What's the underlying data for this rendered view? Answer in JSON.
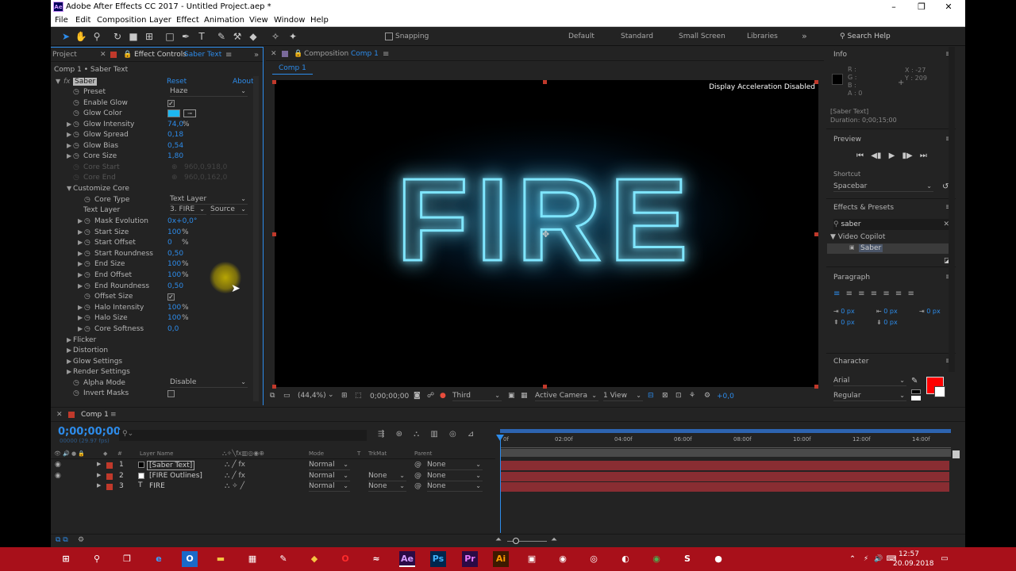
{
  "app": {
    "title": "Adobe After Effects CC 2017 - Untitled Project.aep *",
    "logo": "Ae"
  },
  "window_controls": {
    "minimize": "–",
    "maximize": "❐",
    "close": "✕"
  },
  "menu": [
    "File",
    "Edit",
    "Composition",
    "Layer",
    "Effect",
    "Animation",
    "View",
    "Window",
    "Help"
  ],
  "toolbar": {
    "snapping": "Snapping",
    "workspaces": [
      "Default",
      "Standard",
      "Small Screen",
      "Libraries"
    ],
    "search_help": "Search Help"
  },
  "project_panel": {
    "tab": "Project",
    "effect_controls_label": "Effect Controls",
    "effect_controls_layer": "Saber Text",
    "breadcrumb": "Comp 1 • Saber Text"
  },
  "effect": {
    "fx": "fx",
    "name": "Saber",
    "reset": "Reset",
    "about": "About",
    "preset_label": "Preset",
    "preset_value": "Haze",
    "props": [
      {
        "label": "Enable Glow",
        "type": "check",
        "value": "✓"
      },
      {
        "label": "Glow Color",
        "type": "color",
        "value": ""
      },
      {
        "label": "Glow Intensity",
        "value": "74,0",
        "unit": "%"
      },
      {
        "label": "Glow Spread",
        "value": "0,18"
      },
      {
        "label": "Glow Bias",
        "value": "0,54"
      },
      {
        "label": "Core Size",
        "value": "1,80"
      },
      {
        "label": "Core Start",
        "value": "960,0,918,0",
        "dim": true
      },
      {
        "label": "Core End",
        "value": "960,0,162,0",
        "dim": true
      }
    ],
    "customize_core": "Customize Core",
    "core_type_label": "Core Type",
    "core_type_value": "Text Layer",
    "text_layer_label": "Text Layer",
    "text_layer_value": "3. FIRE",
    "text_layer_source": "Source",
    "sub": [
      {
        "label": "Mask Evolution",
        "value": "0x+0,0°"
      },
      {
        "label": "Start Size",
        "value": "100",
        "unit": "%"
      },
      {
        "label": "Start Offset",
        "value": "0",
        "unit": "%"
      },
      {
        "label": "Start Roundness",
        "value": "0,50"
      },
      {
        "label": "End Size",
        "value": "100",
        "unit": "%"
      },
      {
        "label": "End Offset",
        "value": "100",
        "unit": "%"
      },
      {
        "label": "End Roundness",
        "value": "0,50"
      },
      {
        "label": "Offset Size",
        "type": "check",
        "value": "✓"
      },
      {
        "label": "Halo Intensity",
        "value": "100",
        "unit": "%"
      },
      {
        "label": "Halo Size",
        "value": "100",
        "unit": "%"
      },
      {
        "label": "Core Softness",
        "value": "0,0"
      }
    ],
    "groups": [
      "Flicker",
      "Distortion",
      "Glow Settings",
      "Render Settings"
    ],
    "alpha_mode_label": "Alpha Mode",
    "alpha_mode_value": "Disable",
    "invert_masks_label": "Invert Masks"
  },
  "composition": {
    "tab_prefix": "Composition",
    "tab_name": "Comp 1",
    "subtab": "Comp 1",
    "notice": "Display Acceleration Disabled",
    "text": "FIRE",
    "footer": {
      "zoom": "(44,4%)",
      "time": "0;00;00;00",
      "resolution": "Third",
      "camera": "Active Camera",
      "views": "1 View",
      "exposure": "+0,0"
    }
  },
  "info": {
    "title": "Info",
    "r": "R :",
    "g": "G :",
    "b": "B :",
    "a": "A : 0",
    "x": "X : -27",
    "y": "Y : 209",
    "layer": "[Saber Text]",
    "duration": "Duration: 0;00;15;00"
  },
  "preview": {
    "title": "Preview",
    "shortcut_label": "Shortcut",
    "shortcut_value": "Spacebar"
  },
  "effects_presets": {
    "title": "Effects & Presets",
    "search": "saber",
    "category": "Video Copilot",
    "item": "Saber"
  },
  "paragraph": {
    "title": "Paragraph",
    "values": [
      "0 px",
      "0 px",
      "0 px",
      "0 px",
      "0 px"
    ]
  },
  "character": {
    "title": "Character",
    "font": "Arial",
    "style": "Regular"
  },
  "timeline": {
    "tab": "Comp 1",
    "timecode": "0;00;00;00",
    "fps": "00000 (29.97 fps)",
    "cols": {
      "layer_name": "Layer Name",
      "mode": "Mode",
      "t": "T",
      "trkmat": "TrkMat",
      "parent": "Parent",
      "num": "#"
    },
    "ruler": [
      "0f",
      "02:00f",
      "04:00f",
      "06:00f",
      "08:00f",
      "10:00f",
      "12:00f",
      "14:00f"
    ],
    "layers": [
      {
        "num": "1",
        "name": "[Saber Text]",
        "mode": "Normal",
        "trkmat": "",
        "parent": "None",
        "color": "#c0392b",
        "selected": true
      },
      {
        "num": "2",
        "name": "[FIRE Outlines]",
        "mode": "Normal",
        "trkmat": "None",
        "parent": "None",
        "color": "#c0392b"
      },
      {
        "num": "3",
        "name": "FIRE",
        "mode": "Normal",
        "trkmat": "None",
        "parent": "None",
        "color": "#c0392b"
      }
    ]
  },
  "taskbar": {
    "time": "12:57",
    "date": "20.09.2018"
  }
}
